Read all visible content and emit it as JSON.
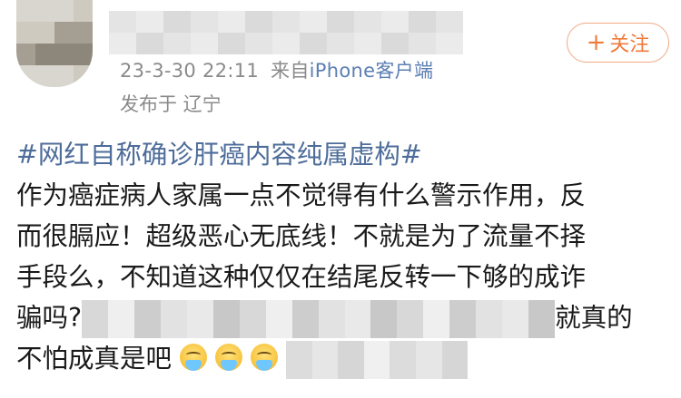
{
  "header": {
    "timestamp": "23-3-30 22:11",
    "from_prefix": "来自",
    "source": "iPhone客户端",
    "location": "发布于 辽宁",
    "follow_plus": "+",
    "follow_label": "关注"
  },
  "post": {
    "hashtag": "#网红自称确诊肝癌内容纯属虚构#",
    "line2": "作为癌症病人家属一点不觉得有什么警示作用，反",
    "line3": "而很膈应！超级恶心无底线！不就是为了流量不择",
    "line4": "手段么，不知道这种仅仅在结尾反转一下够的成诈",
    "line5_start": "骗吗?",
    "line5_end": "就真的",
    "line6": "不怕成真是吧",
    "emojis": [
      "crying-face",
      "crying-face",
      "crying-face"
    ]
  },
  "colors": {
    "hashtag": "#4e6d9a",
    "source": "#5b7fb3",
    "follow": "#f07a3b",
    "meta": "#8a8a8a"
  }
}
